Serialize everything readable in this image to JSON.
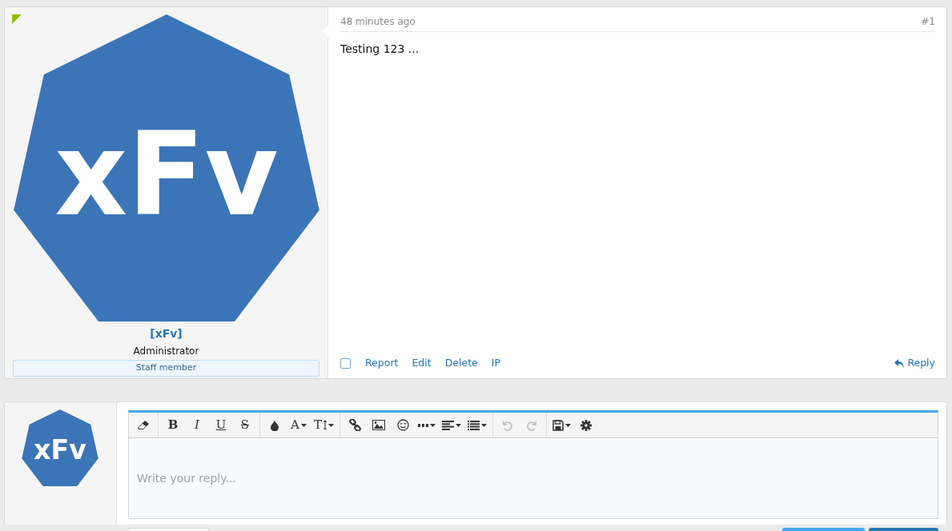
{
  "post": {
    "is_new": true,
    "avatar_letters": "xFv",
    "username": "[xFv]",
    "user_title": "Administrator",
    "banner": "Staff member",
    "time": "48 minutes ago",
    "number": "#1",
    "body": "Testing 123 ...",
    "select_checkbox": {
      "checked": false
    },
    "actions": [
      "Report",
      "Edit",
      "Delete",
      "IP"
    ],
    "reply_link": "Reply"
  },
  "quick_reply": {
    "avatar_letters": "xFv",
    "toolbar": [
      [
        {
          "kind": "eraser",
          "disabled": false
        }
      ],
      [
        {
          "kind": "bold",
          "label": "B",
          "disabled": false
        },
        {
          "kind": "italic",
          "label": "I",
          "disabled": false
        },
        {
          "kind": "underline",
          "label": "U",
          "disabled": false
        },
        {
          "kind": "strike",
          "label": "S",
          "disabled": false
        }
      ],
      [
        {
          "kind": "color",
          "disabled": false
        },
        {
          "kind": "font",
          "label": "A",
          "dropdown": true,
          "disabled": false
        },
        {
          "kind": "size",
          "label": "T",
          "dropdown": true,
          "disabled": false
        }
      ],
      [
        {
          "kind": "link",
          "disabled": false
        },
        {
          "kind": "image",
          "disabled": false
        },
        {
          "kind": "smiley",
          "disabled": false
        },
        {
          "kind": "more",
          "dropdown": true,
          "disabled": false
        },
        {
          "kind": "align",
          "dropdown": true,
          "disabled": false
        },
        {
          "kind": "list",
          "dropdown": true,
          "disabled": false
        }
      ],
      [
        {
          "kind": "undo",
          "disabled": true
        },
        {
          "kind": "redo",
          "disabled": true
        }
      ],
      [
        {
          "kind": "save",
          "dropdown": true,
          "disabled": false
        },
        {
          "kind": "gear",
          "disabled": false
        }
      ]
    ],
    "placeholder": "Write your reply...",
    "buttons": [
      {
        "kind": "plain"
      },
      {
        "kind": "light"
      },
      {
        "kind": "primary"
      }
    ]
  }
}
